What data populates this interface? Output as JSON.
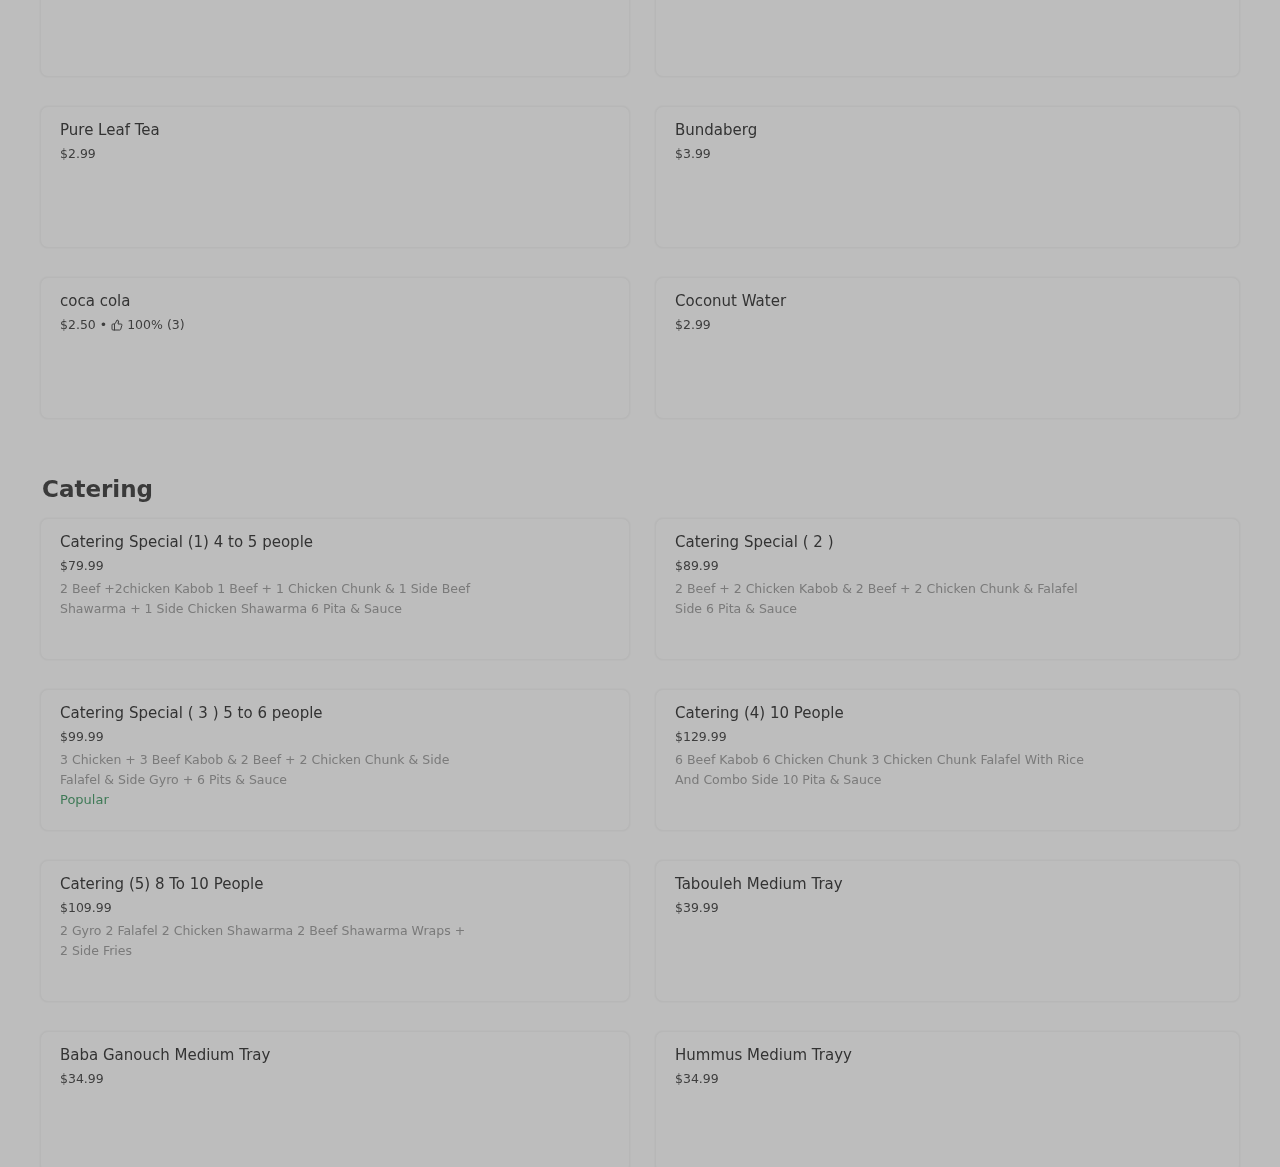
{
  "sections": [
    {
      "items": [
        {
          "name": "Pure Leaf Tea",
          "price": "$2.99"
        },
        {
          "name": "Bundaberg",
          "price": "$3.99"
        },
        {
          "name": "coca cola",
          "price": "$2.50",
          "separator": "•",
          "rating": "100% (3)"
        },
        {
          "name": "Coconut Water",
          "price": "$2.99"
        }
      ]
    },
    {
      "title": "Catering",
      "items": [
        {
          "name": "Catering Special (1) 4 to 5 people",
          "price": "$79.99",
          "description": "2 Beef +2chicken Kabob 1 Beef + 1 Chicken Chunk & 1 Side Beef Shawarma + 1 Side Chicken Shawarma 6 Pita & Sauce"
        },
        {
          "name": "Catering Special ( 2 )",
          "price": "$89.99",
          "description": "2 Beef + 2 Chicken Kabob & 2 Beef + 2 Chicken Chunk & Falafel Side 6 Pita & Sauce"
        },
        {
          "name": "Catering Special ( 3 ) 5 to 6 people",
          "price": "$99.99",
          "description": "3 Chicken + 3 Beef Kabob & 2 Beef + 2 Chicken Chunk & Side Falafel & Side Gyro + 6 Pits & Sauce",
          "badge": "Popular"
        },
        {
          "name": "Catering (4) 10 People",
          "price": "$129.99",
          "description": "6 Beef Kabob 6 Chicken Chunk 3 Chicken Chunk Falafel With Rice And Combo Side 10 Pita & Sauce"
        },
        {
          "name": "Catering (5) 8 To 10 People",
          "price": "$109.99",
          "description": "2 Gyro 2 Falafel 2 Chicken Shawarma 2 Beef Shawarma Wraps + 2 Side Fries"
        },
        {
          "name": "Tabouleh Medium Tray",
          "price": "$39.99"
        },
        {
          "name": "Baba Ganouch Medium Tray",
          "price": "$34.99"
        },
        {
          "name": "Hummus Medium Trayy",
          "price": "$34.99"
        }
      ]
    }
  ]
}
